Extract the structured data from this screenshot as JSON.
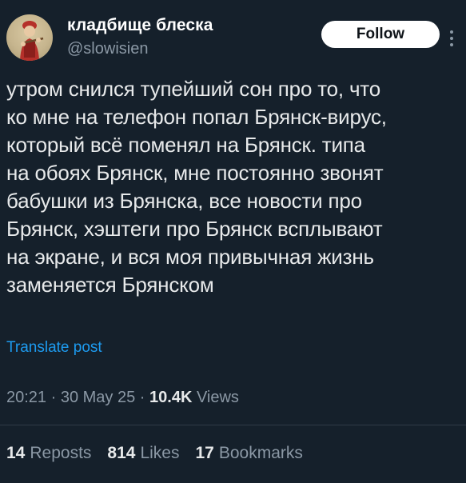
{
  "user": {
    "display_name": "кладбище блеска",
    "handle": "@slowisien"
  },
  "follow_button": {
    "label": "Follow"
  },
  "tweet": {
    "text": "утром снился тупейший сон про то, что\nко мне на телефон попал Брянск-вирус,\nкоторый всё поменял на Брянск. типа\nна обоях Брянск, мне постоянно звонят\nбабушки из Брянска, все новости про\nБрянск, хэштеги про Брянск всплывают\nна экране, и вся моя привычная жизнь\nзаменяется Брянском"
  },
  "translate_link": "Translate post",
  "meta": {
    "time": "20:21",
    "sep1": " · ",
    "date": "30 May 25",
    "sep2": " · ",
    "views_count": "10.4K",
    "views_label": " Views"
  },
  "stats": {
    "reposts_count": "14",
    "reposts_label": "Reposts",
    "likes_count": "814",
    "likes_label": "Likes",
    "bookmarks_count": "17",
    "bookmarks_label": "Bookmarks"
  },
  "colors": {
    "background": "#15202b",
    "text": "#e7e9ea",
    "secondary": "#8b98a5",
    "link": "#1d9bf0"
  }
}
